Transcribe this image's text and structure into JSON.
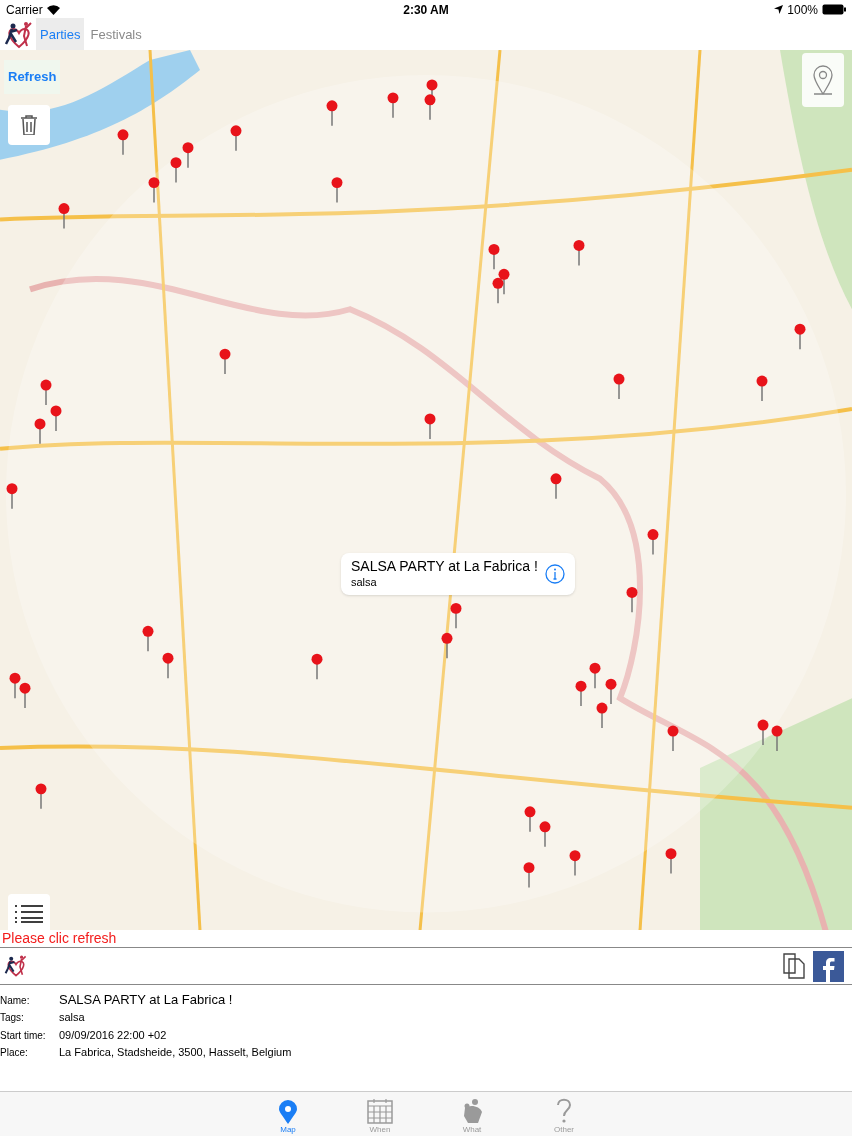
{
  "status_bar": {
    "carrier": "Carrier",
    "time": "2:30 AM",
    "battery": "100%"
  },
  "tabs": [
    {
      "label": "Parties",
      "selected": true
    },
    {
      "label": "Festivals",
      "selected": false
    }
  ],
  "map": {
    "refresh": "Refresh",
    "callout": {
      "title": "SALSA PARTY at La Fabrica !",
      "subtitle": "salsa"
    }
  },
  "message": "Please clic refresh",
  "details": [
    {
      "label": "Name:",
      "value": "SALSA PARTY at La Fabrica !",
      "kind": "title"
    },
    {
      "label": "Tags:",
      "value": "salsa",
      "kind": "plain"
    },
    {
      "label": "Start time:",
      "value": "09/09/2016 22:00 +02",
      "kind": "plain"
    },
    {
      "label": "Place:",
      "value": "La Fabrica, Stadsheide, 3500, Hasselt, Belgium",
      "kind": "plain"
    }
  ],
  "tab_bar": [
    {
      "label": "Map",
      "kind": "map",
      "selected": true
    },
    {
      "label": "When",
      "kind": "when",
      "selected": false
    },
    {
      "label": "What",
      "kind": "what",
      "selected": false
    },
    {
      "label": "Other",
      "kind": "other",
      "selected": false
    }
  ]
}
